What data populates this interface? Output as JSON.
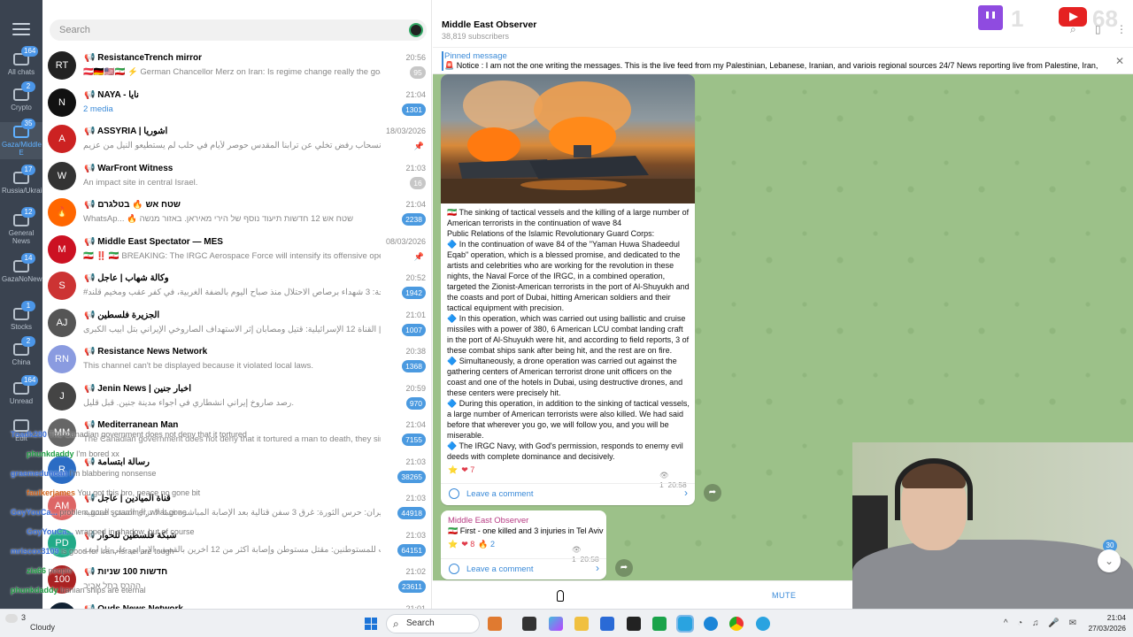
{
  "app": {
    "search_placeholder": "Search"
  },
  "folders": [
    {
      "label": "All chats",
      "badge": "164"
    },
    {
      "label": "Crypto",
      "badge": "2"
    },
    {
      "label": "Gaza/Middle E",
      "badge": "35"
    },
    {
      "label": "Russia/Ukraine",
      "badge": "17"
    },
    {
      "label": "General News",
      "badge": "12"
    },
    {
      "label": "GazaNoNews",
      "badge": "14"
    },
    {
      "label": "Stocks",
      "badge": "1"
    },
    {
      "label": "China",
      "badge": "2"
    },
    {
      "label": "Unread",
      "badge": "164"
    },
    {
      "label": "Edit",
      "badge": ""
    }
  ],
  "chats": [
    {
      "name": "📢 ResistanceTrench mirror",
      "time": "20:56",
      "preview": "🇦🇹🇩🇪🇺🇸🇮🇷 ⚡ German Chancellor Merz on Iran: Is regime change really the goal? If that i...",
      "count": "95",
      "muted": true,
      "avatar": "RT"
    },
    {
      "name": "📢 NAYA - نايا",
      "time": "21:04",
      "preview": "2 media",
      "count": "1301",
      "muted": false,
      "avatar": "N"
    },
    {
      "name": "📢 ASSYRIA | آشوريا",
      "time": "18/03/2026",
      "preview": "رفض الإنسحاب رفض تخلي عن ترابنا المقدس حوصر لأيام في حلب لم يستطيعو النيل من عزيم...",
      "count": "",
      "muted": true,
      "avatar": "A"
    },
    {
      "name": "📢 WarFront Witness",
      "time": "21:03",
      "preview": "An impact site in central Israel.",
      "count": "16",
      "muted": true,
      "avatar": "W"
    },
    {
      "name": "📢 שטח אש 🔥 בטלגרם",
      "time": "21:04",
      "preview": "WhatsAp... 🔥 שטח אש 12 חדשות תיעוד נוסף של הירי מאיראן. באזור מנשה",
      "count": "2238",
      "muted": false,
      "avatar": "🔥"
    },
    {
      "name": "📢 Middle East Spectator — MES",
      "time": "08/03/2026",
      "preview": "🇮🇷 ‼️ 🇮🇷 BREAKING: The IRGC Aerospace Force will intensify its offensive operations sta...",
      "count": "",
      "muted": true,
      "avatar": "M"
    },
    {
      "name": "📢 وكالة شهاب | عاجل",
      "time": "20:52",
      "preview": "#عاجل | وزارة الصحة: 3 شهداء برصاص الاحتلال منذ صباح اليوم بالضفة الغربية، في كفر عقب ومخيم قلند...",
      "count": "1942",
      "muted": false,
      "avatar": "S"
    },
    {
      "name": "📢 الجزيرة فلسطين",
      "time": "21:01",
      "preview": "عاجل | القناة 12 الإسرائيلية: قتيل ومصابان إثر الاستهداف الصاروخي الإيراني بتل أبيب الكبرى",
      "count": "1007",
      "muted": false,
      "avatar": "AJ"
    },
    {
      "name": "📢 Resistance News Network",
      "time": "20:38",
      "preview": "This channel can't be displayed because it violated local laws.",
      "count": "1368",
      "muted": false,
      "avatar": "RN"
    },
    {
      "name": "📢 Jenin News | أخبار جنين",
      "time": "20:59",
      "preview": "رصد صاروخ إيراني انشطاري في أجواء مدينة جنين. قبل قليل.",
      "count": "970",
      "muted": false,
      "avatar": "J"
    },
    {
      "name": "📢 Mediterranean Man",
      "time": "21:04",
      "preview": "The Canadian government does not deny that it tortured a man to death, they sim...",
      "count": "7155",
      "muted": false,
      "avatar": "MM"
    },
    {
      "name": "📢 رسالة ابتسامة",
      "time": "21:03",
      "preview": "",
      "count": "38265",
      "muted": false,
      "avatar": "R"
    },
    {
      "name": "📢 قناة الميادين | عاجل",
      "time": "21:03",
      "preview": "إيران: حرس الثورة: غرق 3 سفن قتالية بعد الإصابة المباشرة فيما لا تزال السفن المتبقية...",
      "count": "44918",
      "muted": false,
      "avatar": "AM"
    },
    {
      "name": "📢 شبكة فلسطين للحوار",
      "time": "21:03",
      "preview": "منصات للمستوطنين: مقتل مستوطن وإصابة أكثر من 12 آخرين بالقصف الإيراني على تل أبيب",
      "count": "64151",
      "muted": false,
      "avatar": "PD"
    },
    {
      "name": "📢 חדשות 100 שניות",
      "time": "21:02",
      "preview": "ההרס בתל אביב",
      "count": "23611",
      "muted": false,
      "avatar": "100"
    },
    {
      "name": "📢 Quds News Network",
      "time": "21:01",
      "preview": "",
      "count": "",
      "muted": false,
      "avatar": "Q"
    }
  ],
  "header": {
    "title": "Middle East Observer",
    "subscribers": "38,819 subscribers"
  },
  "pinned": {
    "title": "Pinned message",
    "text": "🚨 Notice : I am not the one writing the messages. This is the live feed from my Palestinian, Lebanese, Iranian, and variois regional sources  24/7 News reporting live from Palestine, Iran, L..."
  },
  "messages": {
    "m1": {
      "lines": [
        "🇮🇷 The sinking of tactical vessels and the killing of a large number of American terrorists in the continuation of wave 84",
        "Public Relations of the Islamic Revolutionary Guard Corps:",
        "🔷 In the continuation of wave 84 of the \"Yaman Huwa Shadeedul Eqab\" operation, which is a blessed promise, and dedicated to the artists and celebrities who are working for the revolution in these nights, the Naval Force of the IRGC, in a combined operation, targeted the Zionist-American terrorists in the port of Al-Shuyukh and the coasts and port of Dubai, hitting American soldiers and their tactical equipment with precision.",
        "🔷 In this operation, which was carried out using ballistic and cruise missiles with a power of 380, 6 American LCU combat landing craft in the port of Al-Shuyukh were hit, and according to field reports, 3 of these combat ships sank after being hit, and the rest are on fire.",
        "🔷 Simultaneously, a drone operation was carried out against the gathering centers of American terrorist drone unit officers on the coast and one of the hotels in Dubai, using destructive drones, and these centers were precisely hit.",
        "🔷 During this operation, in addition to the sinking of tactical vessels, a large number of American terrorists were also killed. We had said before that wherever you go, we will follow you, and you will be miserable.",
        "🔷 The IRGC Navy, with God's permission, responds to enemy evil deeds with complete dominance and decisively."
      ],
      "reactions": [
        {
          "emoji": "⭐",
          "count": ""
        },
        {
          "emoji": "❤",
          "count": "7"
        }
      ],
      "views": "1",
      "time": "20:58",
      "comment": "Leave a comment"
    },
    "m2": {
      "sender": "Middle East Observer",
      "text": "🇮🇷 First - one killed and 3 injuries in Tel Aviv",
      "reactions": [
        {
          "emoji": "⭐",
          "count": ""
        },
        {
          "emoji": "❤",
          "count": "8"
        },
        {
          "emoji": "🔥",
          "count": "2"
        }
      ],
      "views": "1",
      "time": "20:58",
      "comment": "Leave a comment"
    }
  },
  "scroll_badge": "30",
  "bottom": {
    "mute": "MUTE"
  },
  "taskbar": {
    "weather": "Cloudy",
    "weather_temp": "3",
    "search": "Search",
    "time": "21:04",
    "date": "27/03/2026"
  },
  "stream": {
    "twitch_count": "1",
    "youtube_count": "68",
    "chat": [
      {
        "user": "Toadk280",
        "text": "The Canadian government does not deny that it tortured",
        "color": "u1"
      },
      {
        "user": "phunkdaddy",
        "text": "I'm bored xx",
        "color": "u2"
      },
      {
        "user": "graemeduncan",
        "text": "I'm blabbering nonsense",
        "color": "u1"
      },
      {
        "user": "faulkerjames",
        "text": "You got this bro, peace no gone bit",
        "color": "u3"
      },
      {
        "user": "GoyYouCa...",
        "text": "problem gone scrammer, what gone",
        "color": "u1"
      },
      {
        "user": "GoyYouCa...",
        "text": "wrapped in shadow, but of course",
        "color": "u1"
      },
      {
        "user": "mriscox3109",
        "text": "is good for Iran, Israel are tough",
        "color": "u1"
      },
      {
        "user": "zia66",
        "text": "people",
        "color": "u2"
      },
      {
        "user": "phunkdaddy",
        "text": "Iranian ships are eternal",
        "color": "u2"
      }
    ]
  }
}
